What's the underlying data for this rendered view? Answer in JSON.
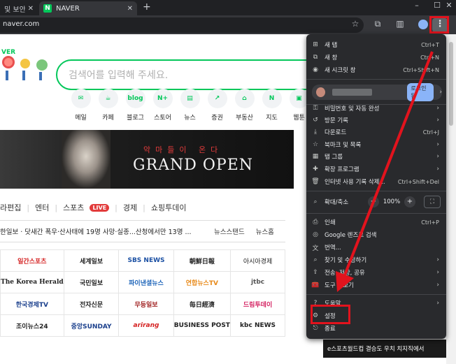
{
  "tabs": [
    {
      "label": "및 보안",
      "active": false
    },
    {
      "label": "NAVER",
      "active": true,
      "favicon": "N"
    }
  ],
  "window": {
    "minimize": "–",
    "maximize": "☐",
    "close": "✕"
  },
  "omnibox": {
    "url": "naver.com"
  },
  "page": {
    "search_placeholder": "검색어를 입력해 주세요.",
    "shortcuts": [
      {
        "label": "메일",
        "icon": "mail-icon",
        "glyph": "✉"
      },
      {
        "label": "카페",
        "icon": "cafe-icon",
        "glyph": "☕"
      },
      {
        "label": "블로그",
        "icon": "blog-icon",
        "glyph": "blog"
      },
      {
        "label": "스토어",
        "icon": "store-icon",
        "glyph": "N+"
      },
      {
        "label": "뉴스",
        "icon": "news-icon",
        "glyph": "▤"
      },
      {
        "label": "증권",
        "icon": "stock-icon",
        "glyph": "↗"
      },
      {
        "label": "부동산",
        "icon": "realestate-icon",
        "glyph": "⌂"
      },
      {
        "label": "지도",
        "icon": "map-icon",
        "glyph": "N"
      },
      {
        "label": "웹툰",
        "icon": "webtoon-icon",
        "glyph": "▣"
      }
    ],
    "banner": {
      "subtitle": "악마들이 온다",
      "title": "GRAND OPEN"
    },
    "categories": [
      "라편집",
      "엔터",
      "스포츠",
      "경제",
      "쇼핑투데이"
    ],
    "live_badge": "LIVE",
    "headline": "한일보 · 닷새간 폭우·산사태에 19명 사망·실종...산청에서만 13명 ...",
    "news_stand": "뉴스스탠드",
    "news_home": "뉴스홈",
    "press": [
      [
        "일간스포츠",
        "세계일보",
        "SBS NEWS",
        "朝鮮日報",
        "아시아경제"
      ],
      [
        "The Korea Herald",
        "국민일보",
        "파이낸셜뉴스",
        "연합뉴스TV",
        "jtbc"
      ],
      [
        "한국경제TV",
        "전자신문",
        "무등일보",
        "毎日經濟",
        "드림투데이"
      ],
      [
        "조이뉴스24",
        "중앙SUNDAY",
        "arirang",
        "BUSINESS POST",
        "kbc NEWS"
      ]
    ],
    "ad_text": "e스포츠월드컵 결승도 우치 치지직에서"
  },
  "menu": {
    "items_top": [
      {
        "label": "새 탭",
        "shortcut": "Ctrl+T",
        "icon": "new-tab-icon",
        "glyph": "⊞"
      },
      {
        "label": "새 창",
        "shortcut": "Ctrl+N",
        "icon": "new-window-icon",
        "glyph": "⧉"
      },
      {
        "label": "새 시크릿 창",
        "shortcut": "Ctrl+Shift+N",
        "icon": "incognito-icon",
        "glyph": "◉"
      }
    ],
    "login_label": "로그인됨",
    "items_mid": [
      {
        "label": "비밀번호 및 자동 완성",
        "icon": "key-icon",
        "glyph": "⚿",
        "sub": true
      },
      {
        "label": "방문 기록",
        "icon": "history-icon",
        "glyph": "↺",
        "sub": true
      },
      {
        "label": "다운로드",
        "shortcut": "Ctrl+J",
        "icon": "download-icon",
        "glyph": "⤓"
      },
      {
        "label": "북마크 및 목록",
        "icon": "bookmark-icon",
        "glyph": "☆",
        "sub": true
      },
      {
        "label": "탭 그룹",
        "icon": "tab-group-icon",
        "glyph": "▦",
        "sub": true
      },
      {
        "label": "확장 프로그램",
        "icon": "extension-icon",
        "glyph": "✚",
        "sub": true
      },
      {
        "label": "인터넷 사용 기록 삭제...",
        "shortcut": "Ctrl+Shift+Del",
        "icon": "trash-icon",
        "glyph": "🗑"
      }
    ],
    "zoom": {
      "label": "확대/축소",
      "minus": "−",
      "value": "100%",
      "plus": "+",
      "fullscreen": "⛶"
    },
    "items_bottom": [
      {
        "label": "인쇄",
        "shortcut": "Ctrl+P",
        "icon": "print-icon",
        "glyph": "⎙"
      },
      {
        "label": "Google 렌즈로 검색",
        "icon": "lens-icon",
        "glyph": "◎"
      },
      {
        "label": "번역...",
        "icon": "translate-icon",
        "glyph": "文"
      },
      {
        "label": "찾기 및 수정하기",
        "icon": "find-icon",
        "glyph": "⌕",
        "sub": true
      },
      {
        "label": "전송, 저장, 공유",
        "icon": "share-icon",
        "glyph": "⇪",
        "sub": true
      },
      {
        "label": "도구 더보기",
        "icon": "tools-icon",
        "glyph": "🧰",
        "sub": true
      }
    ],
    "items_end": [
      {
        "label": "도움말",
        "icon": "help-icon",
        "glyph": "?",
        "sub": true
      },
      {
        "label": "설정",
        "icon": "settings-icon",
        "glyph": "⚙"
      },
      {
        "label": "종료",
        "icon": "exit-icon",
        "glyph": "⎋"
      }
    ]
  },
  "colors": {
    "highlight": "#e2131d",
    "naver_green": "#03c75a",
    "menu_bg": "#292a2d"
  }
}
